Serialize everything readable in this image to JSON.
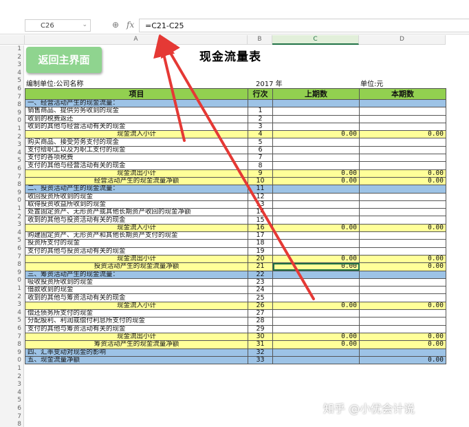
{
  "formula_bar": {
    "name_box": "C26",
    "fx_label": "fx",
    "formula": "=C21-C25"
  },
  "columns": [
    "A",
    "B",
    "C",
    "D"
  ],
  "row_numbers": [
    "1",
    "2",
    "3",
    "4",
    "5",
    "6",
    "7",
    "8",
    "9",
    "0",
    "1",
    "2",
    "3",
    "4",
    "5",
    "6",
    "7",
    "8",
    "9",
    "0",
    "1",
    "2",
    "3",
    "4",
    "5",
    "6",
    "7",
    "8",
    "9",
    "0",
    "1",
    "2",
    "3",
    "4",
    "5",
    "6",
    "7",
    "8",
    "9",
    "0",
    "1",
    "2",
    "3",
    "4",
    "5",
    "6",
    "7",
    "8"
  ],
  "back_button": "返回主界面",
  "title": "现金流量表",
  "meta": {
    "org": "编制单位:公司名称",
    "year": "2017 年",
    "unit": "单位:元"
  },
  "headers": {
    "item": "项目",
    "seq": "行次",
    "prev": "上期数",
    "curr": "本期数"
  },
  "rows": [
    {
      "type": "sec",
      "label": "一、经营活动产生的现金流量：",
      "seq": "",
      "prev": "",
      "curr": ""
    },
    {
      "type": "item",
      "label": "销售商品、提供劳务收到的现金",
      "seq": "1",
      "prev": "",
      "curr": ""
    },
    {
      "type": "item",
      "label": "收到的税费返还",
      "seq": "2",
      "prev": "",
      "curr": ""
    },
    {
      "type": "item",
      "label": "收到的其他与经营活动有关的现金",
      "seq": "3",
      "prev": "",
      "curr": ""
    },
    {
      "type": "sub",
      "label": "现金流入小计",
      "seq": "4",
      "prev": "0.00",
      "curr": "0.00"
    },
    {
      "type": "item",
      "label": "购买商品、接受劳务支付的现金",
      "seq": "5",
      "prev": "",
      "curr": ""
    },
    {
      "type": "item",
      "label": "支付给职工以及为职工支付的现金",
      "seq": "6",
      "prev": "",
      "curr": ""
    },
    {
      "type": "item",
      "label": "支付的各项税费",
      "seq": "7",
      "prev": "",
      "curr": ""
    },
    {
      "type": "item",
      "label": "支付的其他与经营活动有关的现金",
      "seq": "8",
      "prev": "",
      "curr": ""
    },
    {
      "type": "sub",
      "label": "现金流出小计",
      "seq": "9",
      "prev": "0.00",
      "curr": "0.00"
    },
    {
      "type": "tot",
      "label": "经营活动产生的现金流量净额",
      "seq": "10",
      "prev": "0.00",
      "curr": "0.00"
    },
    {
      "type": "sec",
      "label": "二、投资活动产生的现金流量：",
      "seq": "11",
      "prev": "",
      "curr": ""
    },
    {
      "type": "item",
      "label": "收回投资所收到的现金",
      "seq": "12",
      "prev": "",
      "curr": ""
    },
    {
      "type": "item",
      "label": "取得投资收益所收到的现金",
      "seq": "13",
      "prev": "",
      "curr": ""
    },
    {
      "type": "item",
      "label": "处置固定资产、无形资产或其他长期资产收回的现金净额",
      "seq": "14",
      "prev": "",
      "curr": ""
    },
    {
      "type": "item",
      "label": "收到的其他与投资活动有关的现金",
      "seq": "15",
      "prev": "",
      "curr": ""
    },
    {
      "type": "sub",
      "label": "现金流入小计",
      "seq": "16",
      "prev": "0.00",
      "curr": "0.00"
    },
    {
      "type": "item",
      "label": "购建固定资产、无形资产和其他长期资产支付的现金",
      "seq": "17",
      "prev": "",
      "curr": ""
    },
    {
      "type": "item",
      "label": "投资所支付的现金",
      "seq": "18",
      "prev": "",
      "curr": ""
    },
    {
      "type": "item",
      "label": "支付的其他与投资活动有关的现金",
      "seq": "19",
      "prev": "",
      "curr": ""
    },
    {
      "type": "sub",
      "label": "现金流出小计",
      "seq": "20",
      "prev": "0.00",
      "curr": "0.00"
    },
    {
      "type": "tot",
      "label": "投资活动产生的现金流量净额",
      "seq": "21",
      "prev": "0.00",
      "curr": "0.00",
      "selected": true
    },
    {
      "type": "sec",
      "label": "三、筹资活动产生的现金流量：",
      "seq": "22",
      "prev": "",
      "curr": ""
    },
    {
      "type": "item",
      "label": "吸收投资所收到的现金",
      "seq": "23",
      "prev": "",
      "curr": ""
    },
    {
      "type": "item",
      "label": "借款收到的现金",
      "seq": "24",
      "prev": "",
      "curr": ""
    },
    {
      "type": "item",
      "label": "收到的其他与筹资活动有关的现金",
      "seq": "25",
      "prev": "",
      "curr": ""
    },
    {
      "type": "sub",
      "label": "现金流入小计",
      "seq": "26",
      "prev": "0.00",
      "curr": "0.00"
    },
    {
      "type": "item",
      "label": "偿还债务所支付的现金",
      "seq": "27",
      "prev": "",
      "curr": ""
    },
    {
      "type": "item",
      "label": "分配股利、利润或偿付利息所支付的现金",
      "seq": "28",
      "prev": "",
      "curr": ""
    },
    {
      "type": "item",
      "label": "支付的其他与筹资活动有关的现金",
      "seq": "29",
      "prev": "",
      "curr": ""
    },
    {
      "type": "sub",
      "label": "现金流出小计",
      "seq": "30",
      "prev": "0.00",
      "curr": "0.00"
    },
    {
      "type": "tot",
      "label": "筹资活动产生的现金流量净额",
      "seq": "31",
      "prev": "0.00",
      "curr": "0.00"
    },
    {
      "type": "sec",
      "label": "四、汇率变动对现金的影响",
      "seq": "32",
      "prev": "",
      "curr": ""
    },
    {
      "type": "sec",
      "label": "五、现金流量净额",
      "seq": "33",
      "prev": "",
      "curr": "0.00"
    }
  ],
  "watermark": "知乎 @小优会计说",
  "colors": {
    "header_green": "#92d050",
    "section_blue": "#9dc3e6",
    "subtotal_yellow": "#ffff99",
    "arrow_red": "#e53935",
    "button_green": "#8fd48f"
  }
}
